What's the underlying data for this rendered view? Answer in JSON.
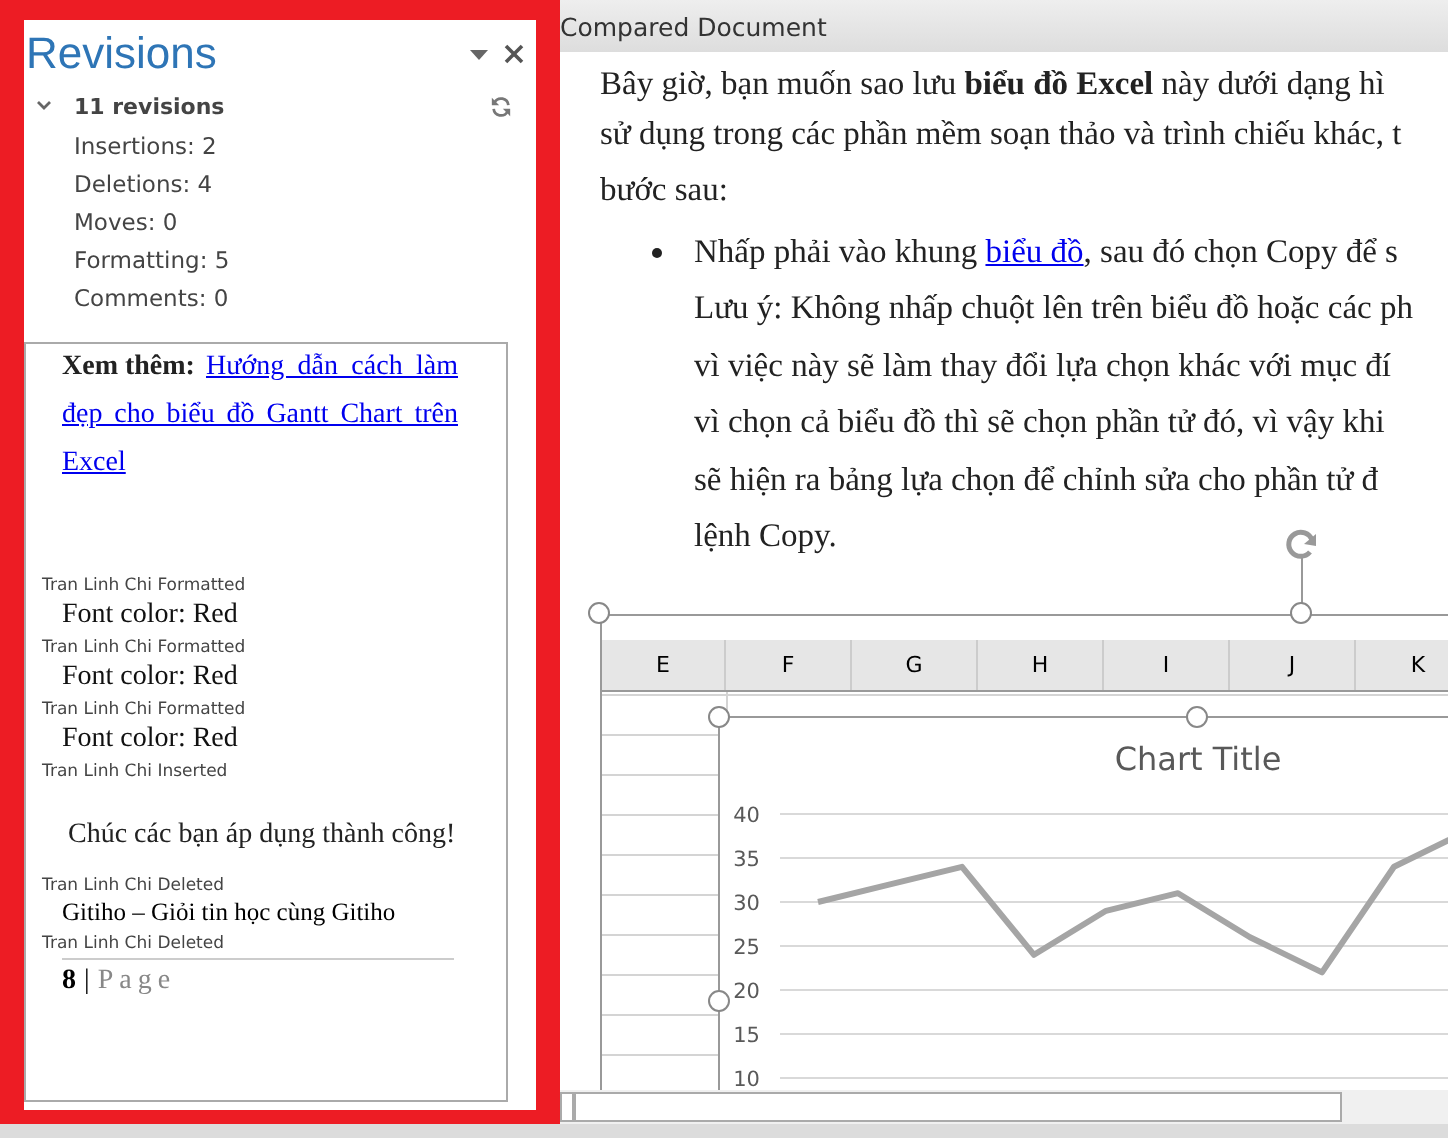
{
  "revisions_pane": {
    "title": "Revisions",
    "summary": "11 revisions",
    "expanded": true,
    "counts": [
      "Insertions: 2",
      "Deletions: 4",
      "Moves: 0",
      "Formatting: 5",
      "Comments: 0"
    ],
    "see_also": {
      "label": "Xem thêm:",
      "link": "Hướng dẫn cách làm đẹp cho biểu đồ Gantt Chart trên Excel"
    },
    "entries": [
      {
        "author": "Tran Linh Chi Formatted",
        "kind": "text",
        "content": "Font color: Red"
      },
      {
        "author": "Tran Linh Chi Formatted",
        "kind": "text",
        "content": "Font color: Red"
      },
      {
        "author": "Tran Linh Chi Formatted",
        "kind": "text",
        "content": "Font color: Red"
      },
      {
        "author": "Tran Linh Chi Inserted",
        "kind": "centered",
        "content": "Chúc các bạn áp dụng thành công!"
      },
      {
        "author": "Tran Linh Chi Deleted",
        "kind": "small",
        "content": "Gitiho – Giỏi tin học cùng Gitiho"
      },
      {
        "author": "Tran Linh Chi Deleted",
        "kind": "page_number",
        "number": "8",
        "separator": "|",
        "content": "Page"
      }
    ]
  },
  "document": {
    "title": "Compared Document",
    "paragraphs": [
      "Bây giờ, bạn muốn sao lưu **biểu đồ Excel** này dưới dạng hì",
      "sử dụng trong các phần mềm soạn thảo và trình chiếu khác, t",
      "bước sau:"
    ],
    "bullet": {
      "before": "Nhấp phải vào khung ",
      "link": "biểu đồ",
      "after": ", sau đó chọn Copy để s"
    },
    "bullet_lines": [
      "Lưu ý: Không nhấp chuột lên trên biểu đồ hoặc các ph",
      "vì việc này sẽ làm thay đổi lựa chọn khác với mục đí",
      "vì chọn cả biểu đồ thì sẽ chọn phần tử đó, vì vậy khi",
      "sẽ hiện ra bảng lựa chọn để chỉnh sửa cho phần tử đ",
      "lệnh Copy."
    ],
    "sheet": {
      "columns": [
        "E",
        "F",
        "G",
        "H",
        "I",
        "J",
        "K"
      ],
      "chart_data": {
        "type": "line",
        "title": "Chart Title",
        "grid": true,
        "ylim": [
          10,
          40
        ],
        "yticks": [
          10,
          15,
          20,
          25,
          30,
          35,
          40
        ],
        "series": [
          {
            "color": "#a5a5a5",
            "values": [
              30,
              32,
              34,
              24,
              29,
              31,
              26,
              22,
              34,
              38
            ]
          }
        ]
      }
    }
  }
}
